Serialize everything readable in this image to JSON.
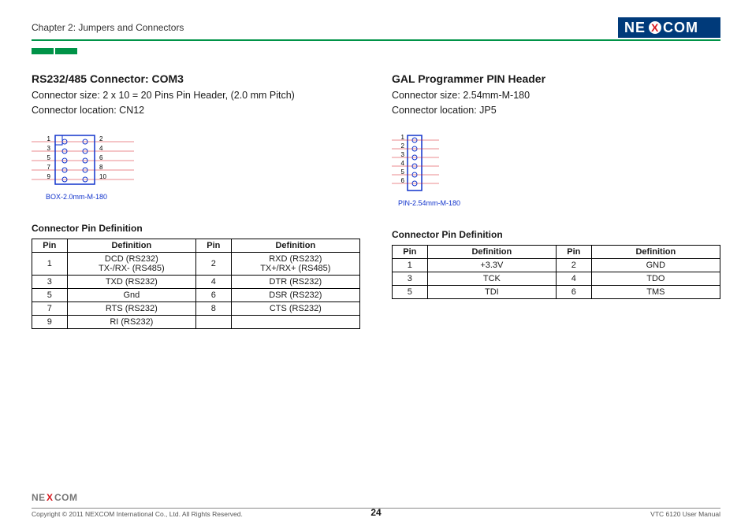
{
  "header": {
    "chapter": "Chapter 2: Jumpers and Connectors"
  },
  "left": {
    "title": "RS232/485 Connector: COM3",
    "size": "Connector size: 2 x 10 = 20 Pins Pin Header, (2.0 mm Pitch)",
    "location": "Connector location: CN12",
    "diagram_label": "BOX-2.0mm-M-180",
    "pins_label": [
      "1",
      "2",
      "3",
      "4",
      "5",
      "6",
      "7",
      "8",
      "9",
      "10"
    ],
    "table_caption": "Connector Pin Definition",
    "headers": [
      "Pin",
      "Definition",
      "Pin",
      "Definition"
    ],
    "rows": [
      [
        "1",
        "DCD (RS232)\nTX-/RX- (RS485)",
        "2",
        "RXD (RS232)\nTX+/RX+ (RS485)"
      ],
      [
        "3",
        "TXD (RS232)",
        "4",
        "DTR (RS232)"
      ],
      [
        "5",
        "Gnd",
        "6",
        "DSR (RS232)"
      ],
      [
        "7",
        "RTS (RS232)",
        "8",
        "CTS (RS232)"
      ],
      [
        "9",
        "RI (RS232)",
        "",
        ""
      ]
    ]
  },
  "right": {
    "title": "GAL Programmer PIN Header",
    "size": "Connector size: 2.54mm-M-180",
    "location": "Connector location: JP5",
    "diagram_label": "PIN-2.54mm-M-180",
    "pins_label": [
      "1",
      "2",
      "3",
      "4",
      "5",
      "6"
    ],
    "table_caption": "Connector Pin Definition",
    "headers": [
      "Pin",
      "Definition",
      "Pin",
      "Definition"
    ],
    "rows": [
      [
        "1",
        "+3.3V",
        "2",
        "GND"
      ],
      [
        "3",
        "TCK",
        "4",
        "TDO"
      ],
      [
        "5",
        "TDI",
        "6",
        "TMS"
      ]
    ]
  },
  "footer": {
    "copyright": "Copyright © 2011 NEXCOM International Co., Ltd. All Rights Reserved.",
    "page": "24",
    "manual": "VTC 6120 User Manual"
  }
}
